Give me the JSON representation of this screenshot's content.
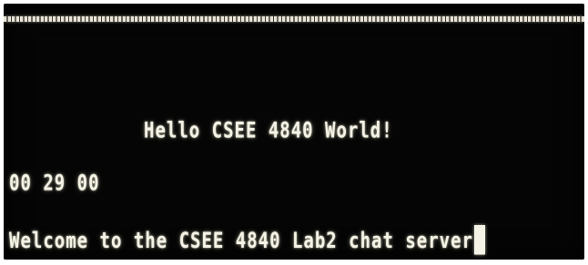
{
  "terminal": {
    "separator_row": "****************************************************************",
    "banner": "Hello CSEE 4840 World!",
    "clock": "00 29 00",
    "status": "Welcome to the CSEE 4840 Lab2 chat server"
  },
  "colors": {
    "background": "#050505",
    "foreground": "#f5f2e6"
  }
}
